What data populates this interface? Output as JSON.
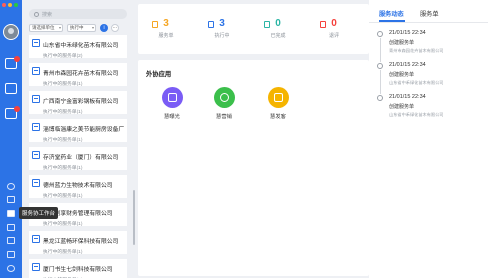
{
  "colors": {
    "accent": "#2c73e6",
    "orange": "#f5a623",
    "blue": "#2c73e6",
    "teal": "#2bb5a5",
    "red": "#f5413d",
    "purple": "#7a5cf5",
    "green": "#3bbf4b",
    "yellow": "#f5b400"
  },
  "nav": {
    "tooltip": "服务协工作台"
  },
  "search": {
    "placeholder": "搜索"
  },
  "filters": {
    "dropdown1": "请选择单位",
    "dropdown2": "执行中"
  },
  "cards": [
    {
      "title": "山东省中禾绿化苗木有限公司",
      "sub": "执行中的服务单(2)"
    },
    {
      "title": "青州市森园花卉苗木有限公司",
      "sub": "执行中的服务单(1)"
    },
    {
      "title": "广西南宁金富彩钢板有限公司",
      "sub": "执行中的服务单(1)"
    },
    {
      "title": "淄博临淄康之美节能厨房设备厂",
      "sub": "执行中的服务单(1)"
    },
    {
      "title": "存济堂药业（厦门）有限公司",
      "sub": "执行中的服务单(1)"
    },
    {
      "title": "德州蓝力生物技术有限公司",
      "sub": "执行中的服务单(1)"
    },
    {
      "title": "郑州创享财务管理有限公司",
      "sub": "执行中的服务单(1)"
    },
    {
      "title": "黑龙江蓝畅环保科技有限公司",
      "sub": "执行中的服务单(1)"
    },
    {
      "title": "厦门书生七剑科技有限公司",
      "sub": "执行中的服务单(1)"
    }
  ],
  "stats": [
    {
      "num": "3",
      "label": "服务单",
      "color": "#f5a623"
    },
    {
      "num": "3",
      "label": "执行中",
      "color": "#2c73e6"
    },
    {
      "num": "0",
      "label": "已完成",
      "color": "#2bb5a5"
    },
    {
      "num": "0",
      "label": "退评",
      "color": "#f5413d"
    }
  ],
  "apps": {
    "title": "外协应用",
    "items": [
      {
        "label": "慧曝光",
        "color": "#7a5cf5"
      },
      {
        "label": "慧营销",
        "color": "#3bbf4b"
      },
      {
        "label": "慧发客",
        "color": "#f5b400"
      }
    ]
  },
  "right": {
    "tabs": [
      "服务动态",
      "服务单"
    ],
    "timeline": [
      {
        "time": "21/01/15 22:34",
        "text": "创建服务单",
        "sub": "青州市森园花卉苗木有限公司"
      },
      {
        "time": "21/01/15 22:34",
        "text": "创建服务单",
        "sub": "山东省中禾绿化苗木有限公司"
      },
      {
        "time": "21/01/15 22:34",
        "text": "创建服务单",
        "sub": "山东省中禾绿化苗木有限公司"
      }
    ]
  }
}
